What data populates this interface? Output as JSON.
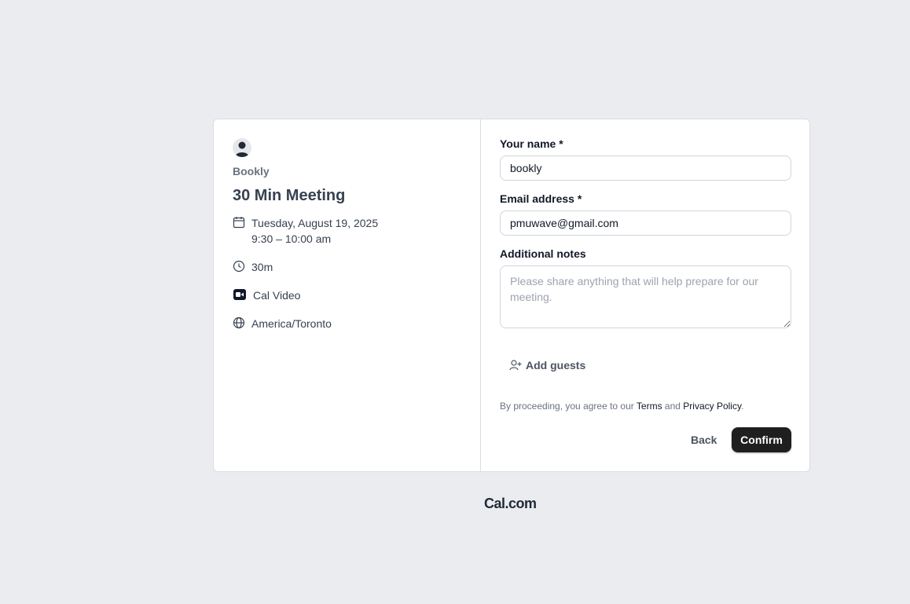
{
  "event": {
    "owner": "Bookly",
    "title": "30 Min Meeting",
    "date": "Tuesday, August 19, 2025",
    "time": "9:30 – 10:00 am",
    "duration": "30m",
    "location": "Cal Video",
    "timezone": "America/Toronto"
  },
  "form": {
    "name_label": "Your name *",
    "name_value": "bookly",
    "email_label": "Email address *",
    "email_value": "pmuwave@gmail.com",
    "notes_label": "Additional notes",
    "notes_placeholder": "Please share anything that will help prepare for our meeting.",
    "add_guests_label": "Add guests"
  },
  "terms": {
    "prefix": "By proceeding, you agree to our ",
    "terms_link": "Terms",
    "and": " and ",
    "privacy_link": "Privacy Policy",
    "suffix": "."
  },
  "actions": {
    "back_label": "Back",
    "confirm_label": "Confirm"
  },
  "footer": {
    "brand": "Cal.com"
  },
  "colors": {
    "page_bg": "#ebecf0",
    "primary_button": "#1f1f1f"
  }
}
